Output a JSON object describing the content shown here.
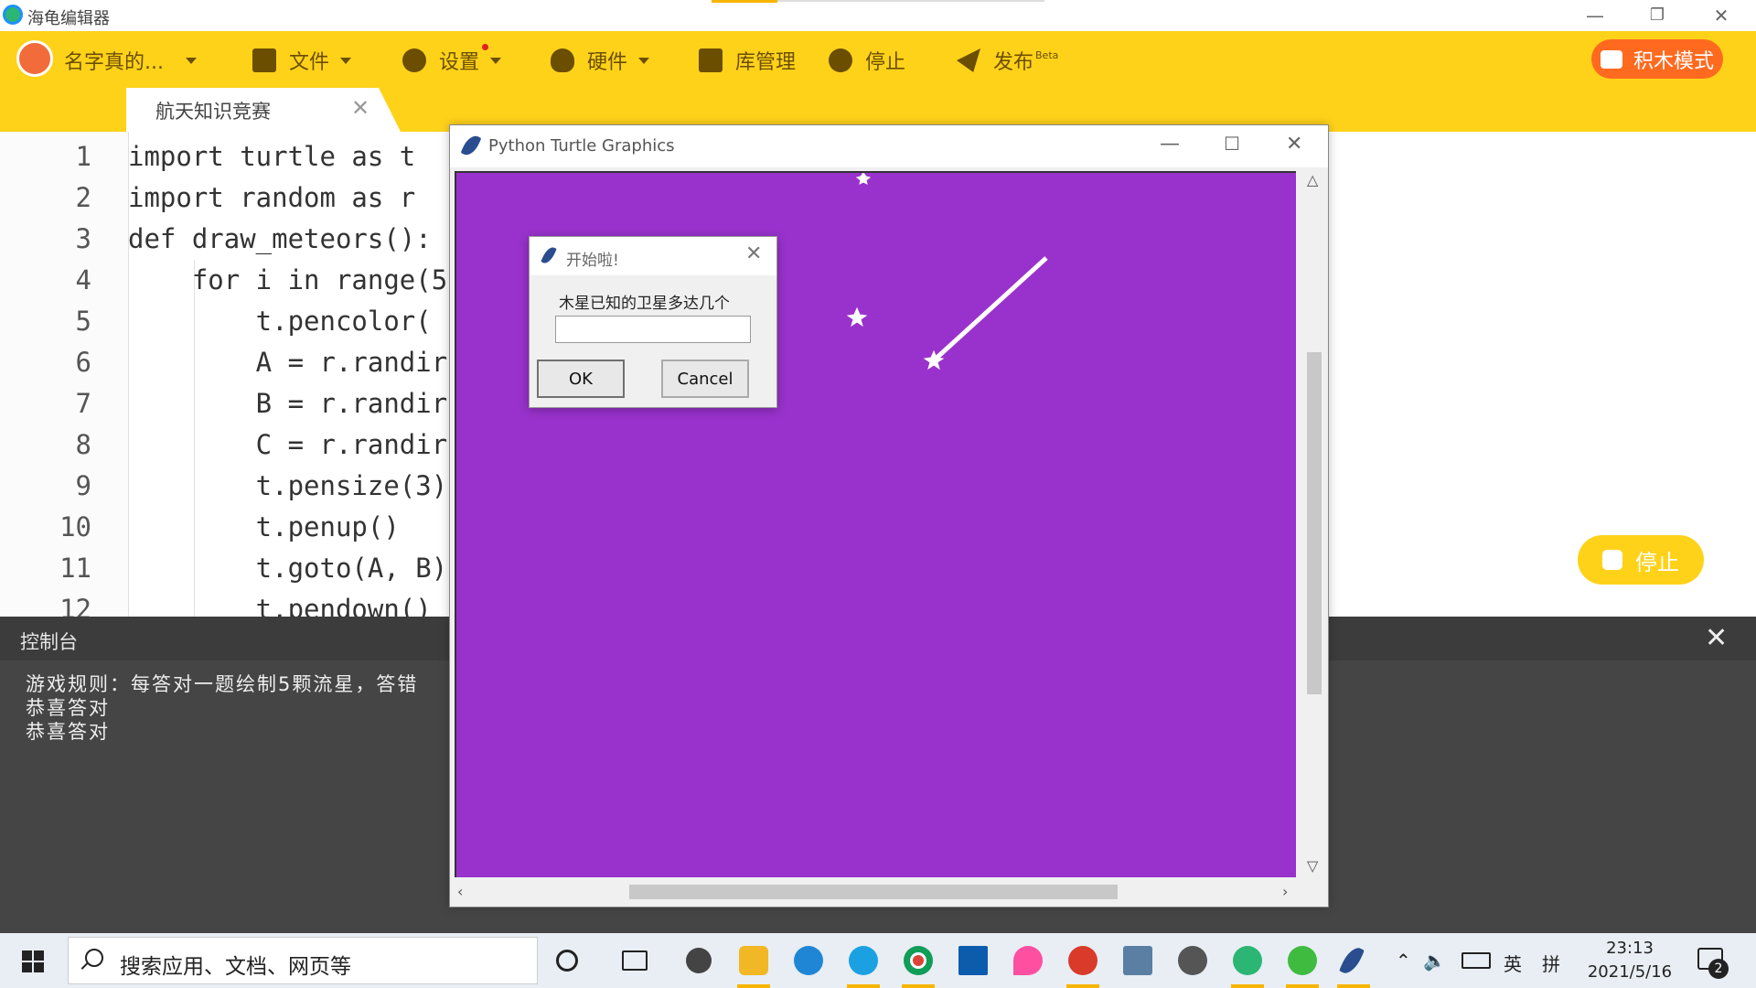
{
  "app": {
    "title": "海龟编辑器"
  },
  "toolbar": {
    "username": "名字真的...",
    "file": "文件",
    "settings": "设置",
    "hardware": "硬件",
    "library": "库管理",
    "stop": "停止",
    "publish": "发布",
    "publish_badge": "Beta",
    "block_mode": "积木模式"
  },
  "tab": {
    "label": "航天知识竞赛"
  },
  "editor": {
    "line_numbers": [
      "1",
      "2",
      "3",
      "4",
      "5",
      "6",
      "7",
      "8",
      "9",
      "10",
      "11",
      "12"
    ],
    "lines": [
      "import turtle as t",
      "import random as r",
      "def draw_meteors():",
      "    for i in range(5",
      "        t.pencolor(",
      "        A = r.randir",
      "        B = r.randir",
      "        C = r.randir",
      "        t.pensize(3)",
      "        t.penup()",
      "        t.goto(A, B)",
      "        t.pendown()"
    ]
  },
  "stop_button": {
    "label": "停止"
  },
  "console": {
    "title": "控制台",
    "lines": [
      "游戏规则：每答对一题绘制5颗流星，答错",
      "恭喜答对",
      "恭喜答对"
    ]
  },
  "turtle_window": {
    "title": "Python Turtle Graphics",
    "canvas_color": "#9932cc"
  },
  "dialog": {
    "title": "开始啦!",
    "prompt": "木星已知的卫星多达几个",
    "input_value": "",
    "ok": "OK",
    "cancel": "Cancel"
  },
  "taskbar": {
    "search_placeholder": "搜索应用、文档、网页等",
    "ime_lang": "英",
    "ime_mode": "拼",
    "time": "23:13",
    "date": "2021/5/16",
    "notification_count": "2"
  },
  "colors": {
    "brand_yellow": "#ffd21a",
    "accent_orange": "#ff6a1f",
    "console_bg": "#454545"
  }
}
